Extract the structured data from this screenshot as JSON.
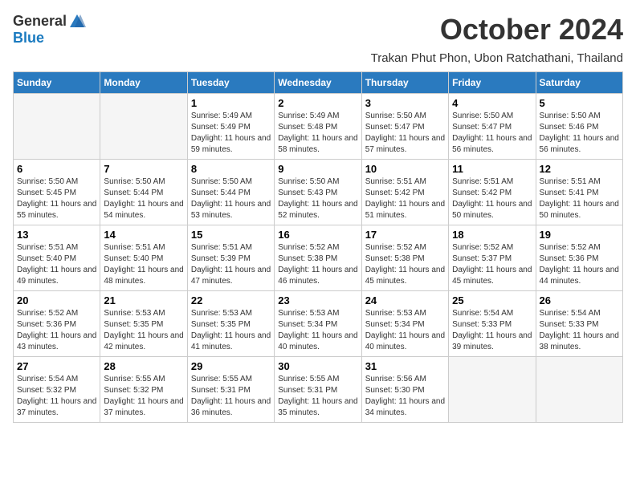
{
  "header": {
    "logo_general": "General",
    "logo_blue": "Blue",
    "month_title": "October 2024",
    "subtitle": "Trakan Phut Phon, Ubon Ratchathani, Thailand"
  },
  "weekdays": [
    "Sunday",
    "Monday",
    "Tuesday",
    "Wednesday",
    "Thursday",
    "Friday",
    "Saturday"
  ],
  "days": [
    {
      "num": "",
      "empty": true
    },
    {
      "num": "",
      "empty": true
    },
    {
      "num": "1",
      "sunrise": "Sunrise: 5:49 AM",
      "sunset": "Sunset: 5:49 PM",
      "daylight": "Daylight: 11 hours and 59 minutes."
    },
    {
      "num": "2",
      "sunrise": "Sunrise: 5:49 AM",
      "sunset": "Sunset: 5:48 PM",
      "daylight": "Daylight: 11 hours and 58 minutes."
    },
    {
      "num": "3",
      "sunrise": "Sunrise: 5:50 AM",
      "sunset": "Sunset: 5:47 PM",
      "daylight": "Daylight: 11 hours and 57 minutes."
    },
    {
      "num": "4",
      "sunrise": "Sunrise: 5:50 AM",
      "sunset": "Sunset: 5:47 PM",
      "daylight": "Daylight: 11 hours and 56 minutes."
    },
    {
      "num": "5",
      "sunrise": "Sunrise: 5:50 AM",
      "sunset": "Sunset: 5:46 PM",
      "daylight": "Daylight: 11 hours and 56 minutes."
    },
    {
      "num": "6",
      "sunrise": "Sunrise: 5:50 AM",
      "sunset": "Sunset: 5:45 PM",
      "daylight": "Daylight: 11 hours and 55 minutes."
    },
    {
      "num": "7",
      "sunrise": "Sunrise: 5:50 AM",
      "sunset": "Sunset: 5:44 PM",
      "daylight": "Daylight: 11 hours and 54 minutes."
    },
    {
      "num": "8",
      "sunrise": "Sunrise: 5:50 AM",
      "sunset": "Sunset: 5:44 PM",
      "daylight": "Daylight: 11 hours and 53 minutes."
    },
    {
      "num": "9",
      "sunrise": "Sunrise: 5:50 AM",
      "sunset": "Sunset: 5:43 PM",
      "daylight": "Daylight: 11 hours and 52 minutes."
    },
    {
      "num": "10",
      "sunrise": "Sunrise: 5:51 AM",
      "sunset": "Sunset: 5:42 PM",
      "daylight": "Daylight: 11 hours and 51 minutes."
    },
    {
      "num": "11",
      "sunrise": "Sunrise: 5:51 AM",
      "sunset": "Sunset: 5:42 PM",
      "daylight": "Daylight: 11 hours and 50 minutes."
    },
    {
      "num": "12",
      "sunrise": "Sunrise: 5:51 AM",
      "sunset": "Sunset: 5:41 PM",
      "daylight": "Daylight: 11 hours and 50 minutes."
    },
    {
      "num": "13",
      "sunrise": "Sunrise: 5:51 AM",
      "sunset": "Sunset: 5:40 PM",
      "daylight": "Daylight: 11 hours and 49 minutes."
    },
    {
      "num": "14",
      "sunrise": "Sunrise: 5:51 AM",
      "sunset": "Sunset: 5:40 PM",
      "daylight": "Daylight: 11 hours and 48 minutes."
    },
    {
      "num": "15",
      "sunrise": "Sunrise: 5:51 AM",
      "sunset": "Sunset: 5:39 PM",
      "daylight": "Daylight: 11 hours and 47 minutes."
    },
    {
      "num": "16",
      "sunrise": "Sunrise: 5:52 AM",
      "sunset": "Sunset: 5:38 PM",
      "daylight": "Daylight: 11 hours and 46 minutes."
    },
    {
      "num": "17",
      "sunrise": "Sunrise: 5:52 AM",
      "sunset": "Sunset: 5:38 PM",
      "daylight": "Daylight: 11 hours and 45 minutes."
    },
    {
      "num": "18",
      "sunrise": "Sunrise: 5:52 AM",
      "sunset": "Sunset: 5:37 PM",
      "daylight": "Daylight: 11 hours and 45 minutes."
    },
    {
      "num": "19",
      "sunrise": "Sunrise: 5:52 AM",
      "sunset": "Sunset: 5:36 PM",
      "daylight": "Daylight: 11 hours and 44 minutes."
    },
    {
      "num": "20",
      "sunrise": "Sunrise: 5:52 AM",
      "sunset": "Sunset: 5:36 PM",
      "daylight": "Daylight: 11 hours and 43 minutes."
    },
    {
      "num": "21",
      "sunrise": "Sunrise: 5:53 AM",
      "sunset": "Sunset: 5:35 PM",
      "daylight": "Daylight: 11 hours and 42 minutes."
    },
    {
      "num": "22",
      "sunrise": "Sunrise: 5:53 AM",
      "sunset": "Sunset: 5:35 PM",
      "daylight": "Daylight: 11 hours and 41 minutes."
    },
    {
      "num": "23",
      "sunrise": "Sunrise: 5:53 AM",
      "sunset": "Sunset: 5:34 PM",
      "daylight": "Daylight: 11 hours and 40 minutes."
    },
    {
      "num": "24",
      "sunrise": "Sunrise: 5:53 AM",
      "sunset": "Sunset: 5:34 PM",
      "daylight": "Daylight: 11 hours and 40 minutes."
    },
    {
      "num": "25",
      "sunrise": "Sunrise: 5:54 AM",
      "sunset": "Sunset: 5:33 PM",
      "daylight": "Daylight: 11 hours and 39 minutes."
    },
    {
      "num": "26",
      "sunrise": "Sunrise: 5:54 AM",
      "sunset": "Sunset: 5:33 PM",
      "daylight": "Daylight: 11 hours and 38 minutes."
    },
    {
      "num": "27",
      "sunrise": "Sunrise: 5:54 AM",
      "sunset": "Sunset: 5:32 PM",
      "daylight": "Daylight: 11 hours and 37 minutes."
    },
    {
      "num": "28",
      "sunrise": "Sunrise: 5:55 AM",
      "sunset": "Sunset: 5:32 PM",
      "daylight": "Daylight: 11 hours and 37 minutes."
    },
    {
      "num": "29",
      "sunrise": "Sunrise: 5:55 AM",
      "sunset": "Sunset: 5:31 PM",
      "daylight": "Daylight: 11 hours and 36 minutes."
    },
    {
      "num": "30",
      "sunrise": "Sunrise: 5:55 AM",
      "sunset": "Sunset: 5:31 PM",
      "daylight": "Daylight: 11 hours and 35 minutes."
    },
    {
      "num": "31",
      "sunrise": "Sunrise: 5:56 AM",
      "sunset": "Sunset: 5:30 PM",
      "daylight": "Daylight: 11 hours and 34 minutes."
    },
    {
      "num": "",
      "empty": true
    },
    {
      "num": "",
      "empty": true
    }
  ]
}
